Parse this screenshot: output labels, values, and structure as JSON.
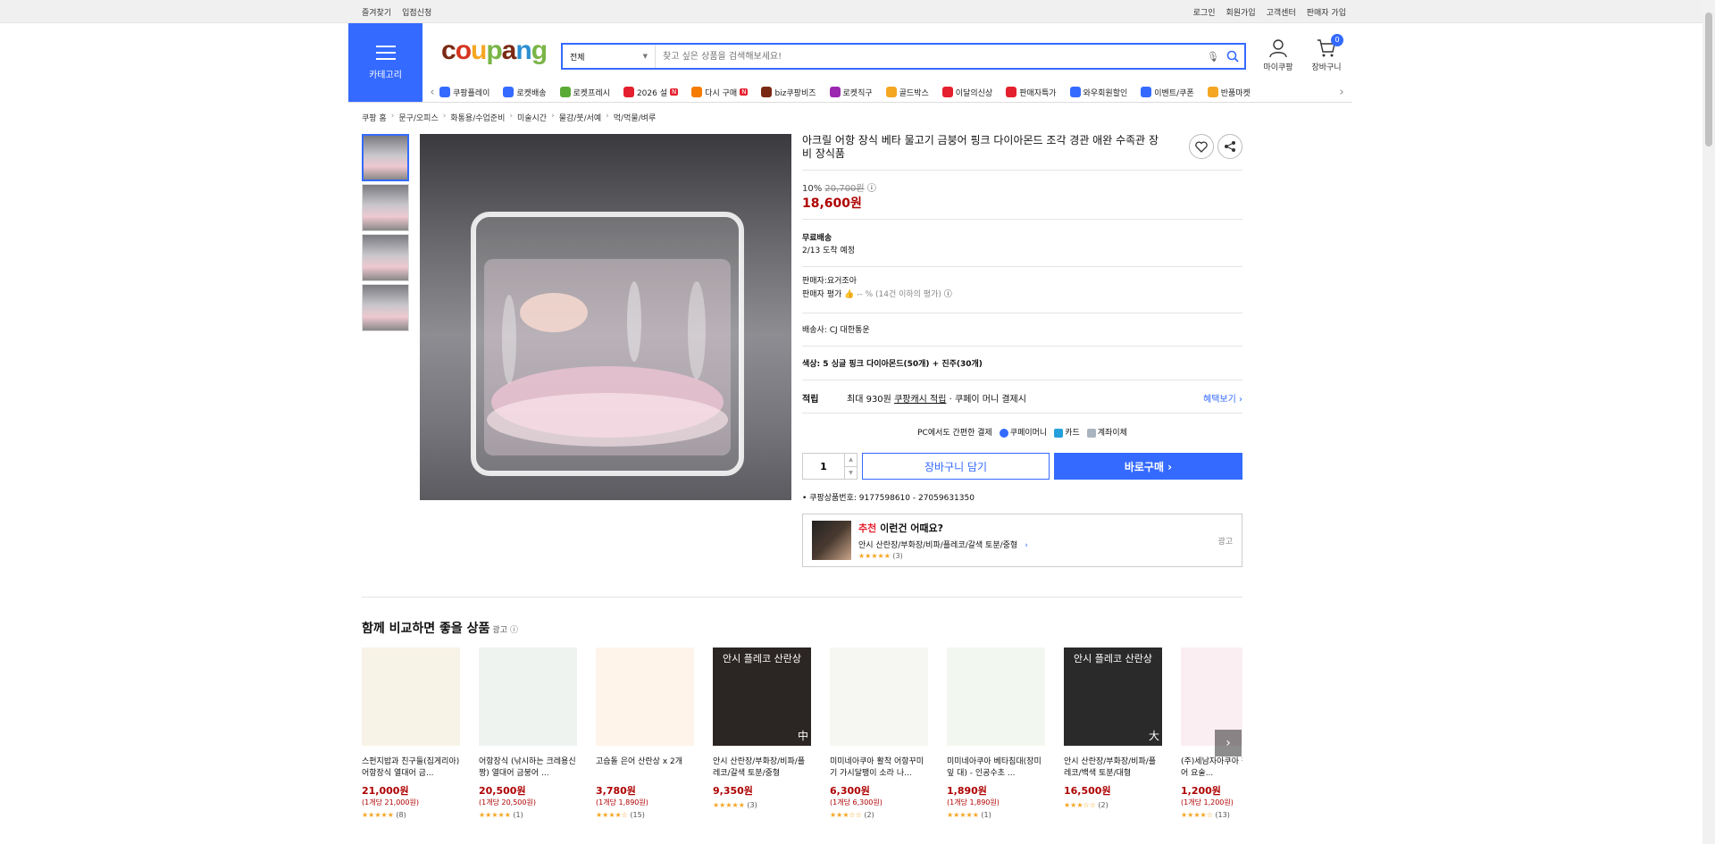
{
  "topbar": {
    "left": [
      "즐겨찾기",
      "입점신청"
    ],
    "right": [
      "로그인",
      "회원가입",
      "고객센터",
      "판매자 가입"
    ]
  },
  "header": {
    "category_label": "카테고리",
    "search": {
      "scope": "전체",
      "placeholder": "찾고 싶은 상품을 검색해보세요!"
    },
    "mypage": "마이쿠팡",
    "cart": "장바구니",
    "cart_count": "0",
    "nav": [
      {
        "label": "쿠팡플레이",
        "color": "#346aff"
      },
      {
        "label": "로켓배송",
        "color": "#346aff"
      },
      {
        "label": "로켓프레시",
        "color": "#5aab35"
      },
      {
        "label": "2026 설",
        "color": "#e5202e",
        "badge": "N"
      },
      {
        "label": "다시 구매",
        "color": "#f57c00",
        "badge": "N"
      },
      {
        "label": "biz쿠팡비즈",
        "color": "#7a2a14"
      },
      {
        "label": "로켓직구",
        "color": "#9c27b0"
      },
      {
        "label": "골드박스",
        "color": "#f5a623"
      },
      {
        "label": "이달의신상",
        "color": "#e5202e"
      },
      {
        "label": "판매자특가",
        "color": "#e5202e"
      },
      {
        "label": "와우회원할인",
        "color": "#346aff"
      },
      {
        "label": "이벤트/쿠폰",
        "color": "#346aff"
      },
      {
        "label": "반품마켓",
        "color": "#f5a623"
      }
    ]
  },
  "breadcrumb": [
    "쿠팡 홈",
    "문구/오피스",
    "화통용/수업준비",
    "미술시간",
    "물감/붓/서예",
    "먹/먹물/벼루"
  ],
  "product": {
    "title": "아크릴 어항 장식 베타 물고기 금붕어 핑크 다이아몬드 조각 경관 애완 수족관 장비 장식품",
    "discount": "10%",
    "orig_price": "20,700원",
    "price": "18,600원",
    "shipping": "무료배송",
    "arrival": "2/13 도착 예정",
    "seller": "판매자:요거조아",
    "seller_rating_label": "판매자 평가",
    "seller_rating_text": "-- % (14건 이하의 평가)",
    "courier": "배송사: CJ 대한통운",
    "option": "색상: 5 싱글 핑크 다이아몬드(50개) + 진주(30개)",
    "reward_label": "적립",
    "reward_text1": "최대 930원",
    "reward_text2": "쿠팡캐시 적립",
    "reward_text3": "· 쿠페이 머니 결제시",
    "reward_more": "혜택보기 ›",
    "pay_text": "PC에서도 간편한 결제",
    "pay_methods": [
      "쿠페이머니",
      "카드",
      "계좌이체"
    ],
    "qty": "1",
    "cart_btn": "장바구니 담기",
    "buy_btn": "바로구매 ›",
    "product_no": "쿠팡상품번호: 9177598610 - 27059631350"
  },
  "recommend": {
    "title_red": "추천",
    "title": "이런건 어때요?",
    "item": "안시 산란장/부화장/비파/플레코/갈색 토분/중형",
    "stars": "★★★★★",
    "count": "(3)",
    "ad": "광고"
  },
  "compare": {
    "heading": "함께 비교하면 좋을 상품",
    "ad": "광고",
    "items": [
      {
        "name": "스펀지밥과 친구들(집게리아) 어항장식 열대어 금...",
        "price": "21,000원",
        "unit": "(1개당 21,000원)",
        "stars": "★★★★★",
        "count": "(8)",
        "bg": "#f7f3e6",
        "label": "",
        "size": ""
      },
      {
        "name": "어항장식 (낚시하는 크레용신짱) 열대어 금붕어 ...",
        "price": "20,500원",
        "unit": "(1개당 20,500원)",
        "stars": "★★★★★",
        "count": "(1)",
        "bg": "#eef3f0",
        "label": "",
        "size": ""
      },
      {
        "name": "고슴돌 은어 산란상 x 2개",
        "price": "3,780원",
        "unit": "(1개당 1,890원)",
        "stars": "★★★★☆",
        "count": "(15)",
        "bg": "#fff4ea",
        "label": "",
        "size": ""
      },
      {
        "name": "안시 산란장/부화장/비파/플레코/갈색 토분/중형",
        "price": "9,350원",
        "unit": "",
        "stars": "★★★★★",
        "count": "(3)",
        "bg": "#2b2523",
        "label": "안시 플레코 산란상",
        "size": "中"
      },
      {
        "name": "미미네아쿠아 활착 어항꾸미기 가시달팽이 소라 나...",
        "price": "6,300원",
        "unit": "(1개당 6,300원)",
        "stars": "★★★☆☆",
        "count": "(2)",
        "bg": "#f6f6f2",
        "label": "",
        "size": ""
      },
      {
        "name": "미미네아쿠아 베타침대(장미잎 대) - 인공수초 ...",
        "price": "1,890원",
        "unit": "(1개당 1,890원)",
        "stars": "★★★★★",
        "count": "(1)",
        "bg": "#f2f7ef",
        "label": "",
        "size": ""
      },
      {
        "name": "안시 산란장/부화장/비파/플레코/백색 토분/대형",
        "price": "16,500원",
        "unit": "",
        "stars": "★★★☆☆",
        "count": "(2)",
        "bg": "#2a2a2a",
        "label": "안시 플레코 산란상",
        "size": "大"
      },
      {
        "name": "(주)세남자아쿠아 장식 피규어 요술...",
        "price": "1,200원",
        "unit": "(1개당 1,200원)",
        "stars": "★★★★☆",
        "count": "(13)",
        "bg": "#fbeef2",
        "label": "",
        "size": ""
      }
    ]
  },
  "colors": {
    "accent": "#346aff",
    "price": "#ae0000",
    "star": "#f5a623"
  }
}
